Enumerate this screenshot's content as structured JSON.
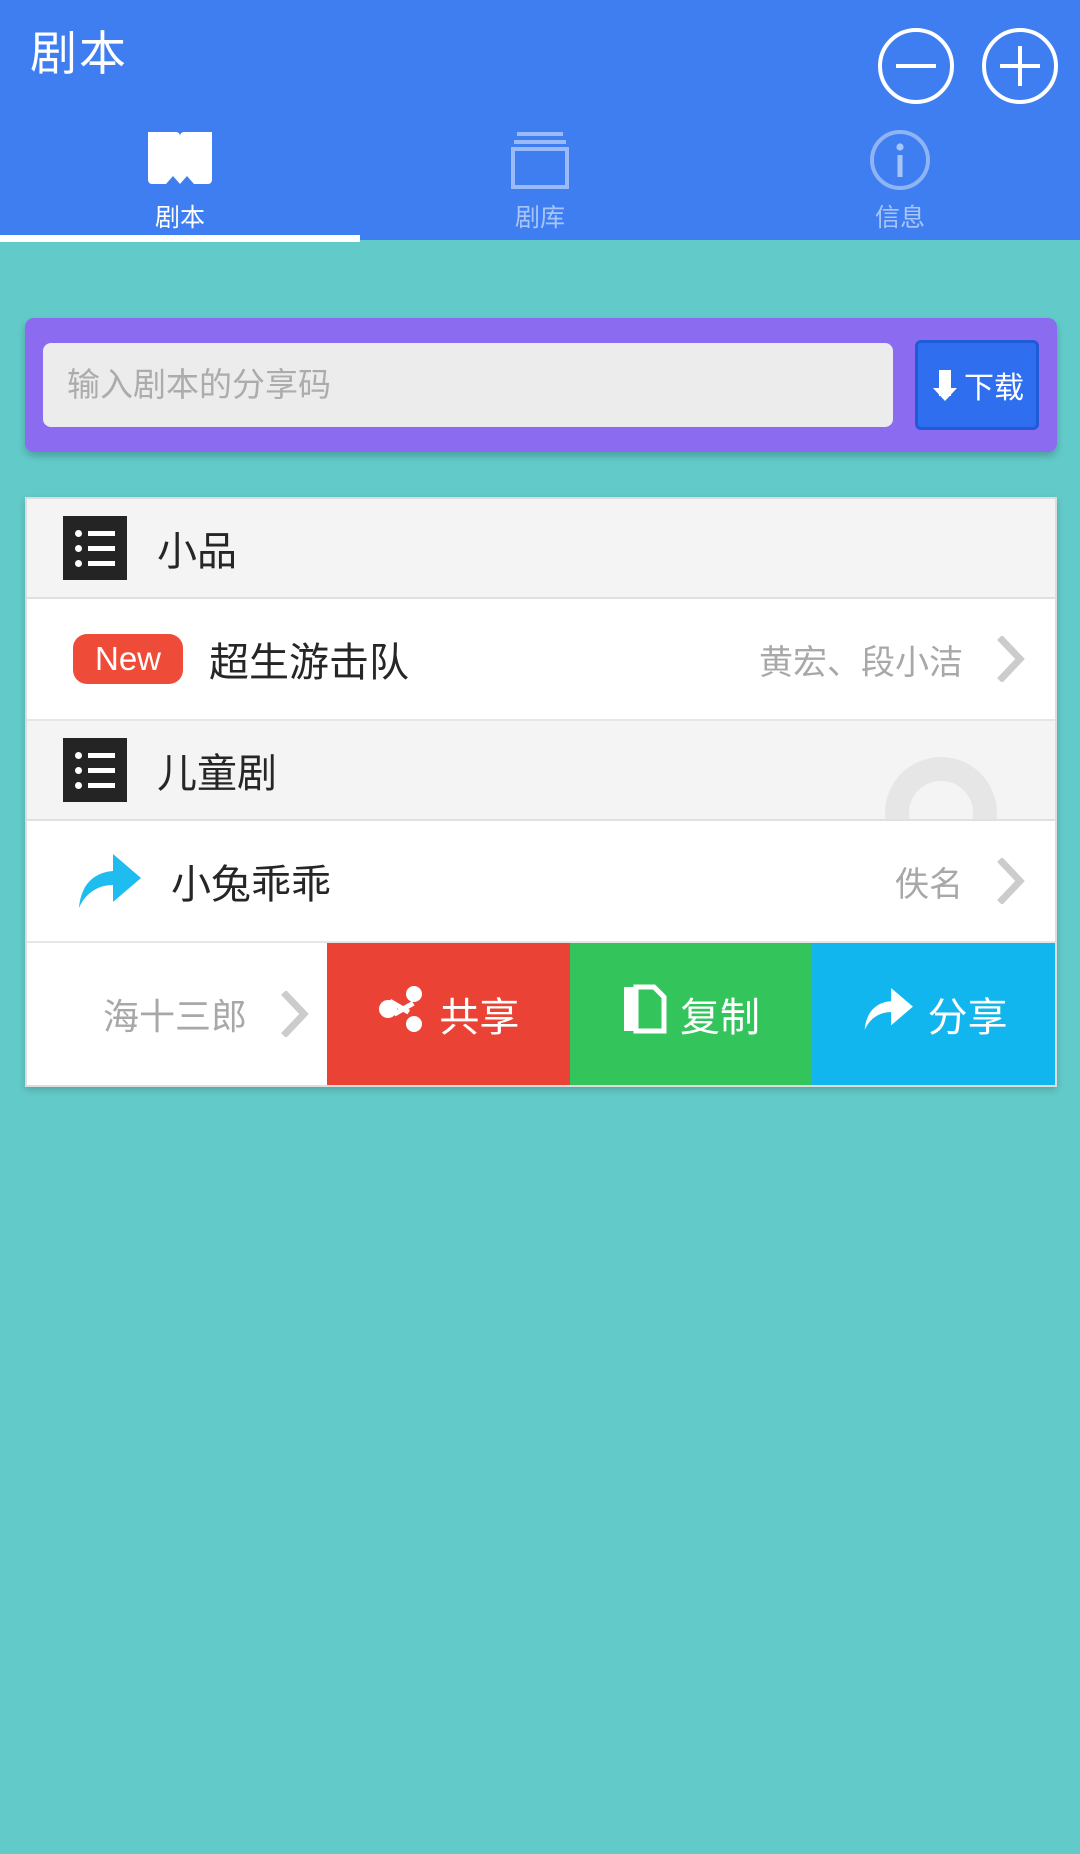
{
  "header": {
    "title": "剧本",
    "actions": [
      {
        "name": "minus-button",
        "glyph": "minus"
      },
      {
        "name": "plus-button",
        "glyph": "plus"
      }
    ],
    "accent_bg": "#3F7EF0"
  },
  "tabs": [
    {
      "label": "剧本",
      "icon": "book-icon",
      "active": true
    },
    {
      "label": "剧库",
      "icon": "library-icon",
      "active": false
    },
    {
      "label": "信息",
      "icon": "info-icon",
      "active": false
    }
  ],
  "download_card": {
    "placeholder": "输入剧本的分享码",
    "value": "",
    "button_label": "下载",
    "card_color": "#8B6BEF",
    "button_color": "#2F6FEF"
  },
  "list": {
    "sections": [
      {
        "category": "小品",
        "items": [
          {
            "badge": "New",
            "title": "超生游击队",
            "author": "黄宏、段小洁",
            "lead_icon": "none"
          }
        ]
      },
      {
        "category": "儿童剧",
        "ripple": true,
        "items": [
          {
            "badge": "",
            "title": "小兔乖乖",
            "author": "佚名",
            "lead_icon": "share-arrow-icon"
          }
        ]
      }
    ],
    "swiped_row": {
      "author": "海十三郎",
      "actions": [
        {
          "label": "共享",
          "icon": "share-nodes-icon",
          "color": "#EA4335"
        },
        {
          "label": "复制",
          "icon": "copy-icon",
          "color": "#33C45C"
        },
        {
          "label": "分享",
          "icon": "forward-arrow-icon",
          "color": "#11B6EE"
        }
      ]
    }
  },
  "background_color": "#62CBC9"
}
